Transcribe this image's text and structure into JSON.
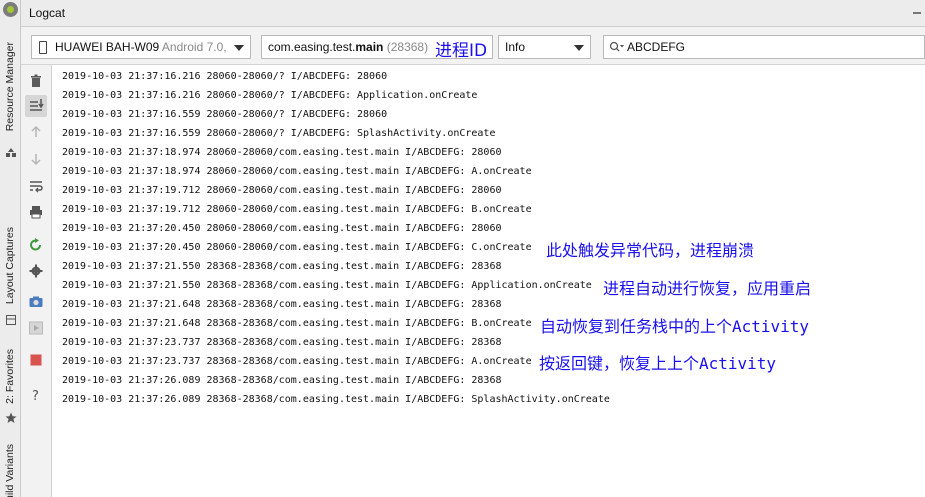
{
  "window": {
    "title": "Logcat"
  },
  "side_tabs": [
    {
      "label": "Resource Manager"
    },
    {
      "label": "Layout Captures"
    },
    {
      "label": "2: Favorites"
    },
    {
      "label": "Build Variants"
    }
  ],
  "toolbar": {
    "device": {
      "name": "HUAWEI BAH-W09",
      "detail": "Android 7.0,"
    },
    "process": {
      "prefix": "com.easing.test.",
      "main": "main",
      "pid": "(28368)"
    },
    "log_level": "Info",
    "search": {
      "value": "ABCDEFG"
    }
  },
  "log_lines": [
    "2019-10-03 21:37:16.216 28060-28060/? I/ABCDEFG: 28060",
    "2019-10-03 21:37:16.216 28060-28060/? I/ABCDEFG: Application.onCreate",
    "2019-10-03 21:37:16.559 28060-28060/? I/ABCDEFG: 28060",
    "2019-10-03 21:37:16.559 28060-28060/? I/ABCDEFG: SplashActivity.onCreate",
    "2019-10-03 21:37:18.974 28060-28060/com.easing.test.main I/ABCDEFG: 28060",
    "2019-10-03 21:37:18.974 28060-28060/com.easing.test.main I/ABCDEFG: A.onCreate",
    "2019-10-03 21:37:19.712 28060-28060/com.easing.test.main I/ABCDEFG: 28060",
    "2019-10-03 21:37:19.712 28060-28060/com.easing.test.main I/ABCDEFG: B.onCreate",
    "2019-10-03 21:37:20.450 28060-28060/com.easing.test.main I/ABCDEFG: 28060",
    "2019-10-03 21:37:20.450 28060-28060/com.easing.test.main I/ABCDEFG: C.onCreate",
    "2019-10-03 21:37:21.550 28368-28368/com.easing.test.main I/ABCDEFG: 28368",
    "2019-10-03 21:37:21.550 28368-28368/com.easing.test.main I/ABCDEFG: Application.onCreate",
    "2019-10-03 21:37:21.648 28368-28368/com.easing.test.main I/ABCDEFG: 28368",
    "2019-10-03 21:37:21.648 28368-28368/com.easing.test.main I/ABCDEFG: B.onCreate",
    "2019-10-03 21:37:23.737 28368-28368/com.easing.test.main I/ABCDEFG: 28368",
    "2019-10-03 21:37:23.737 28368-28368/com.easing.test.main I/ABCDEFG: A.onCreate",
    "2019-10-03 21:37:26.089 28368-28368/com.easing.test.main I/ABCDEFG: 28368",
    "2019-10-03 21:37:26.089 28368-28368/com.easing.test.main I/ABCDEFG: SplashActivity.onCreate"
  ],
  "annotations": {
    "process_id": "进程ID",
    "crash": "此处触发异常代码，进程崩溃",
    "recover": "进程自动进行恢复，应用重启",
    "restore": "自动恢复到任务栈中的上个Activity",
    "back": "按返回键，恢复上上个Activity"
  },
  "colors": {
    "annotation": "#1a10ee",
    "stop": "#d9534f",
    "restart": "#3c9a3c"
  },
  "icons": [
    "android-icon",
    "resource-icon",
    "layout-icon",
    "star-icon",
    "phone-icon",
    "search-icon",
    "trash-icon",
    "scroll-end-icon",
    "up-arrow-icon",
    "down-arrow-icon",
    "soft-wrap-icon",
    "print-icon",
    "restart-icon",
    "settings-icon",
    "screenshot-icon",
    "screen-record-icon",
    "stop-icon",
    "help-icon",
    "minimize-icon"
  ]
}
